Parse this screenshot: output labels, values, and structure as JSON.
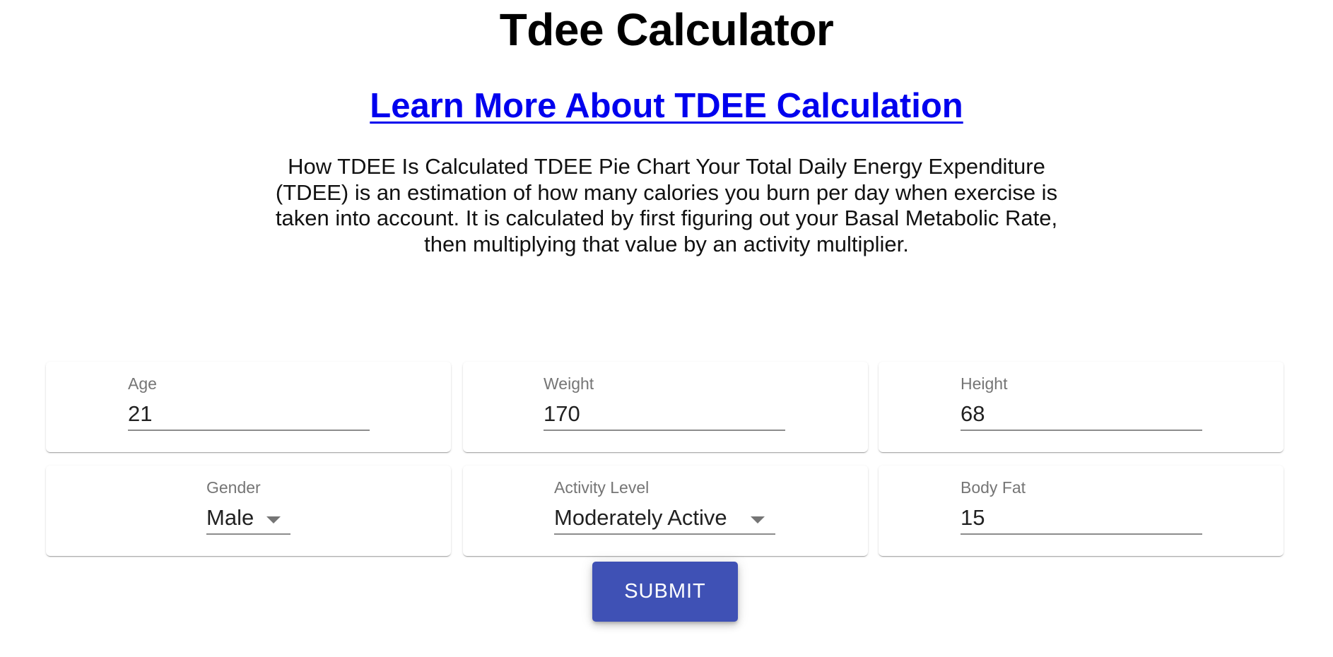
{
  "page": {
    "title": "Tdee Calculator",
    "learn_more_link": "Learn More About TDEE Calculation",
    "description": "How TDEE Is Calculated TDEE Pie Chart Your Total Daily Energy Expenditure (TDEE) is an estimation of how many calories you burn per day when exercise is taken into account. It is calculated by first figuring out your Basal Metabolic Rate, then multiplying that value by an activity multiplier."
  },
  "form": {
    "age": {
      "label": "Age",
      "value": "21"
    },
    "weight": {
      "label": "Weight",
      "value": "170"
    },
    "height": {
      "label": "Height",
      "value": "68"
    },
    "gender": {
      "label": "Gender",
      "value": "Male",
      "icon": "dropdown-arrow-icon"
    },
    "activity_level": {
      "label": "Activity Level",
      "value": "Moderately Active",
      "icon": "dropdown-arrow-icon"
    },
    "body_fat": {
      "label": "Body Fat",
      "value": "15"
    },
    "submit_label": "SUBMIT"
  },
  "colors": {
    "primary": "#3f51b5",
    "link": "#0000ee",
    "label": "#757575",
    "text": "#212121"
  }
}
